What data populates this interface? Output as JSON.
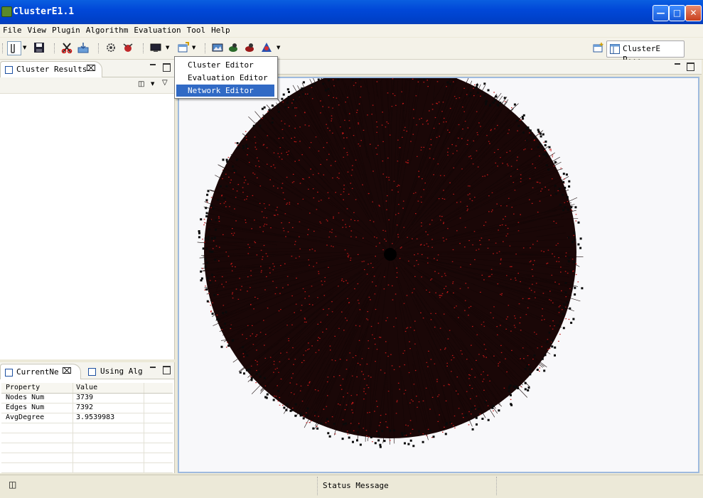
{
  "window": {
    "title": "ClusterE1.1"
  },
  "menu": [
    "File",
    "View",
    "Plugin",
    "Algorithm",
    "Evaluation",
    "Tool",
    "Help"
  ],
  "perspective": {
    "label": "ClusterE p..."
  },
  "dropdown": {
    "items": [
      "Cluster Editor",
      "Evaluation Editor",
      "Network Editor"
    ],
    "selected": "Network Editor"
  },
  "cluster_results": {
    "tab": "Cluster Results"
  },
  "bottom_left": {
    "tabs": [
      "CurrentNe",
      "Using Alg"
    ],
    "columns": [
      "Property",
      "Value"
    ],
    "rows": [
      {
        "property": "Nodes Num",
        "value": "3739"
      },
      {
        "property": "Edges Num",
        "value": "7392"
      },
      {
        "property": "AvgDegree",
        "value": "3.9539983"
      }
    ]
  },
  "network": {
    "nodes_num": 3739,
    "edges_num": 7392,
    "node_color": "#c21818",
    "edge_color": "#140606"
  },
  "status": {
    "message": "Status Message"
  }
}
